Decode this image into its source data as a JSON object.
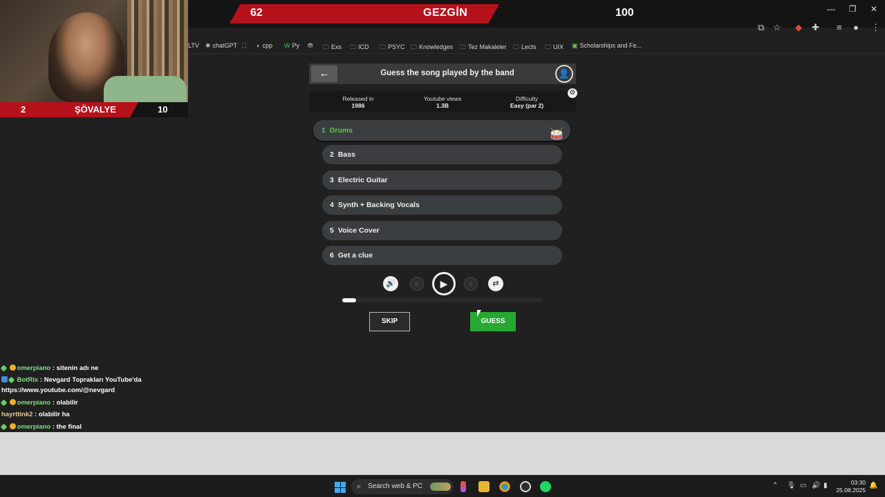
{
  "overlay": {
    "top_bar": {
      "left_score": "62",
      "title": "GEZGİN",
      "right_score": "100"
    },
    "cam_bar": {
      "left_score": "2",
      "title": "ŞÖVALYE",
      "right_score": "10"
    }
  },
  "window_controls": {
    "minimize": "—",
    "restore": "❐",
    "close": "✕"
  },
  "bookmarks": [
    {
      "label": "LTV",
      "icon": ""
    },
    {
      "label": "chatGPT",
      "icon": "openai-icon"
    },
    {
      "label": "",
      "icon": "grid-icon"
    },
    {
      "label": "cpp",
      "icon": "cpp-icon"
    },
    {
      "label": "Py",
      "icon": "python-icon"
    },
    {
      "label": "",
      "icon": "bookmark-icon"
    },
    {
      "label": "Exs",
      "icon": "folder-icon"
    },
    {
      "label": "ICD",
      "icon": "folder-icon"
    },
    {
      "label": "PSYC",
      "icon": "folder-icon"
    },
    {
      "label": "Knowledges",
      "icon": "folder-icon"
    },
    {
      "label": "Tez Makaleler",
      "icon": "folder-icon"
    },
    {
      "label": "Lects",
      "icon": "folder-icon"
    },
    {
      "label": "UIX",
      "icon": "folder-icon"
    },
    {
      "label": "Scholarships and Fe...",
      "icon": "page-icon"
    }
  ],
  "game": {
    "title": "Guess the song played by the band",
    "info": {
      "released_label": "Released in",
      "released_value": "1986",
      "views_label": "Youtube views",
      "views_value": "1.3B",
      "difficulty_label": "Difficulty",
      "difficulty_value": "Easy (par 2)"
    },
    "tracks": [
      {
        "num": "1",
        "label": "Drums"
      },
      {
        "num": "2",
        "label": "Bass"
      },
      {
        "num": "3",
        "label": "Electric Guitar"
      },
      {
        "num": "4",
        "label": "Synth + Backing Vocals"
      },
      {
        "num": "5",
        "label": "Voice Cover"
      },
      {
        "num": "6",
        "label": "Get a clue"
      }
    ],
    "rewind_label": "5",
    "forward_label": "5",
    "progress": 0.07,
    "skip_label": "SKIP",
    "guess_label": "GUESS"
  },
  "chat": [
    {
      "user": "omerpiano",
      "msg": " : sitenin adı ne",
      "badges": [
        "green",
        "gold"
      ],
      "user_color": "green"
    },
    {
      "user": "BotRix",
      "msg": " : Nevgard Toprakları YouTube'da",
      "badges": [
        "blue",
        "green"
      ],
      "user_color": "green"
    },
    {
      "user": "",
      "msg": "https://www.youtube.com/@nevgard",
      "badges": [],
      "user_color": "none"
    },
    {
      "user": "omerpiano",
      "msg": " : olabilir",
      "badges": [
        "green",
        "gold"
      ],
      "user_color": "green"
    },
    {
      "user": "hayrttink2",
      "msg": " : olabilir ha",
      "badges": [],
      "user_color": "tan"
    },
    {
      "user": "omerpiano",
      "msg": " : the final",
      "badges": [
        "green",
        "gold"
      ],
      "user_color": "green"
    }
  ],
  "taskbar": {
    "search_placeholder": "Search web & PC",
    "time": "03:30",
    "date": "25.08.2025"
  },
  "colors": {
    "accent_red": "#b5121b",
    "guess_green": "#27a832",
    "active_track": "#5ec24a"
  }
}
